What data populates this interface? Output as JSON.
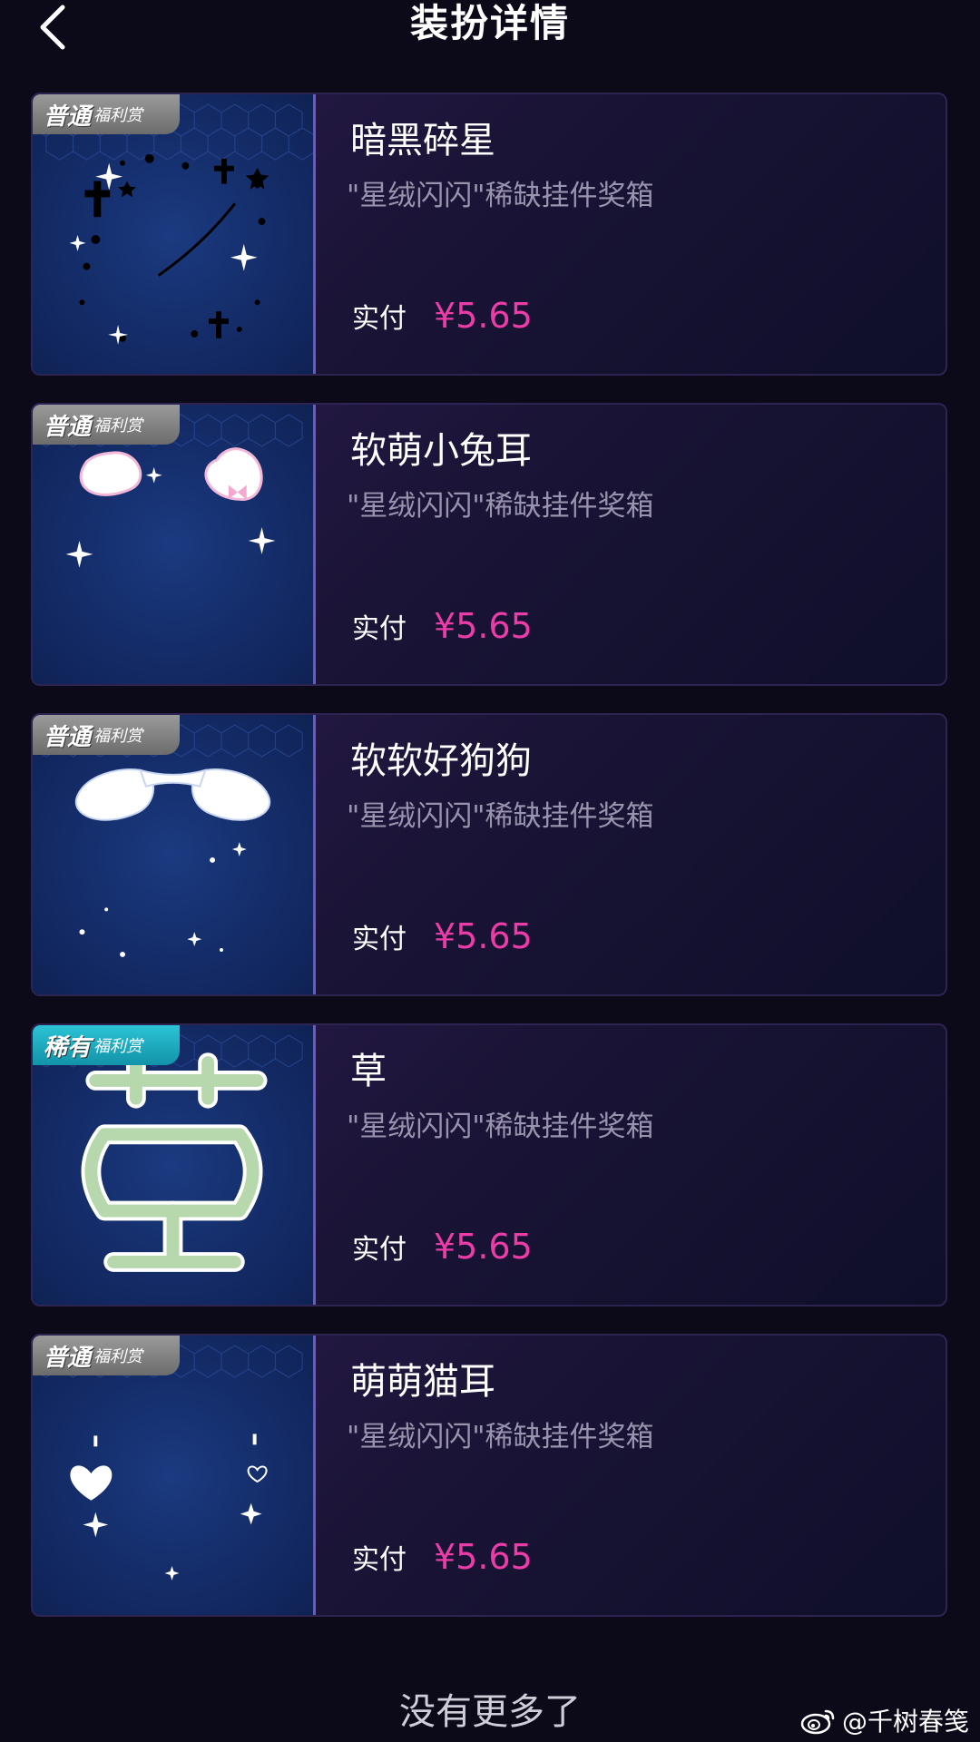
{
  "header": {
    "title": "装扮详情",
    "back_icon": "chevron-left-icon"
  },
  "items": [
    {
      "badge_main": "普通",
      "badge_sub": "福利赏",
      "badge_type": "normal",
      "name": "暗黑碎星",
      "source": "\"星绒闪闪\"稀缺挂件奖箱",
      "price_label": "实付",
      "price": "¥5.65"
    },
    {
      "badge_main": "普通",
      "badge_sub": "福利赏",
      "badge_type": "normal",
      "name": "软萌小兔耳",
      "source": "\"星绒闪闪\"稀缺挂件奖箱",
      "price_label": "实付",
      "price": "¥5.65"
    },
    {
      "badge_main": "普通",
      "badge_sub": "福利赏",
      "badge_type": "normal",
      "name": "软软好狗狗",
      "source": "\"星绒闪闪\"稀缺挂件奖箱",
      "price_label": "实付",
      "price": "¥5.65"
    },
    {
      "badge_main": "稀有",
      "badge_sub": "福利赏",
      "badge_type": "rare",
      "name": "草",
      "source": "\"星绒闪闪\"稀缺挂件奖箱",
      "price_label": "实付",
      "price": "¥5.65"
    },
    {
      "badge_main": "普通",
      "badge_sub": "福利赏",
      "badge_type": "normal",
      "name": "萌萌猫耳",
      "source": "\"星绒闪闪\"稀缺挂件奖箱",
      "price_label": "实付",
      "price": "¥5.65"
    }
  ],
  "footer": {
    "end_text": "没有更多了"
  },
  "watermark": {
    "text": "@千树春笺",
    "icon": "weibo-icon"
  },
  "colors": {
    "background": "#0c0a18",
    "price": "#ec3ca8",
    "badge_normal": "#8a8a8a",
    "badge_rare": "#1fb0c4",
    "thumb_border": "#6b57c6"
  }
}
